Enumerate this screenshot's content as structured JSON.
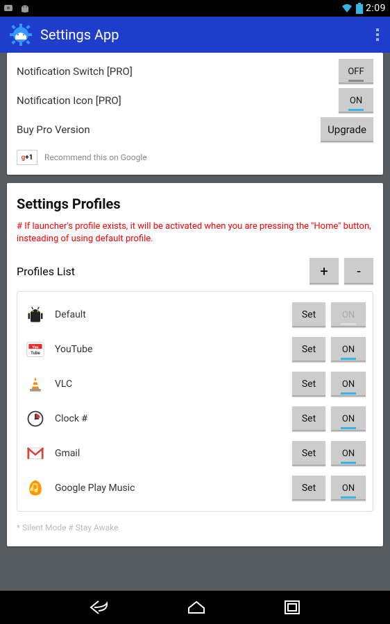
{
  "status": {
    "time": "2:09"
  },
  "appbar": {
    "title": "Settings App"
  },
  "topCard": {
    "rows": [
      {
        "label": "Notification Switch [PRO]",
        "btn": "OFF",
        "state": "off"
      },
      {
        "label": "Notification Icon [PRO]",
        "btn": "ON",
        "state": "on"
      },
      {
        "label": "Buy Pro Version",
        "btn": "Upgrade",
        "state": "wide"
      }
    ],
    "gplus": {
      "badge": "+1",
      "text": "Recommend this on Google"
    }
  },
  "profilesCard": {
    "title": "Settings Profiles",
    "hint": "# If launcher's profile exists, it will be activated when you are pressing the \"Home\" button, insteading of using default profile.",
    "listTitle": "Profiles List",
    "add": "+",
    "remove": "-",
    "setLabel": "Set",
    "items": [
      {
        "name": "Default",
        "icon": "android",
        "toggle": "ON",
        "state": "disabled"
      },
      {
        "name": "YouTube",
        "icon": "youtube",
        "toggle": "ON",
        "state": "on"
      },
      {
        "name": "VLC",
        "icon": "vlc",
        "toggle": "ON",
        "state": "on"
      },
      {
        "name": "Clock #",
        "icon": "clock",
        "toggle": "ON",
        "state": "on"
      },
      {
        "name": "Gmail",
        "icon": "gmail",
        "toggle": "ON",
        "state": "on"
      },
      {
        "name": "Google Play Music",
        "icon": "music",
        "toggle": "ON",
        "state": "on"
      }
    ],
    "legend": "* Silent Mode    # Stay Awake"
  }
}
